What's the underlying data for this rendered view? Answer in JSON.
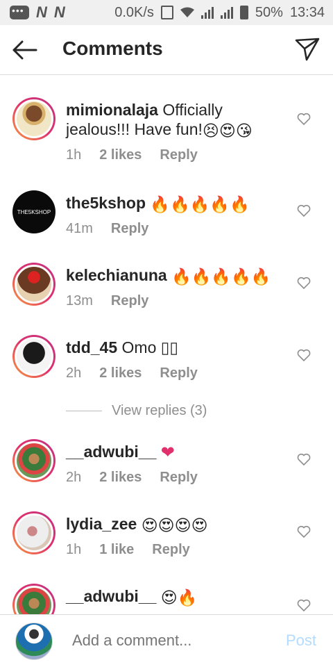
{
  "status_bar": {
    "carrier_1": "N",
    "carrier_2": "N",
    "speed": "0.0K/s",
    "battery": "50%",
    "time": "13:34"
  },
  "header": {
    "title": "Comments"
  },
  "comments": [
    {
      "username": "mimionalaja",
      "text": "Officially jealous!!! Have fun!",
      "emojis": "😣😍😘",
      "time": "1h",
      "likes": "2 likes",
      "reply": "Reply"
    },
    {
      "username": "the5kshop",
      "text": "",
      "emojis": "🔥🔥🔥🔥🔥",
      "time": "41m",
      "likes": "",
      "reply": "Reply",
      "avatar_text": "THE5KSHOP"
    },
    {
      "username": "kelechianuna",
      "text": "",
      "emojis": "🔥🔥🔥🔥🔥",
      "time": "13m",
      "likes": "",
      "reply": "Reply"
    },
    {
      "username": "tdd_45",
      "text": "Omo ▯▯",
      "emojis": "",
      "time": "2h",
      "likes": "2 likes",
      "reply": "Reply"
    },
    {
      "username": "__adwubi__",
      "text": "",
      "emojis": "❤",
      "time": "2h",
      "likes": "2 likes",
      "reply": "Reply"
    },
    {
      "username": "lydia_zee",
      "text": "",
      "emojis": "😍😍😍😍",
      "time": "1h",
      "likes": "1 like",
      "reply": "Reply"
    },
    {
      "username": "__adwubi__",
      "text": "",
      "emojis": "😍🔥",
      "time": "",
      "likes": "",
      "reply": ""
    }
  ],
  "view_replies": "View replies (3)",
  "composer": {
    "placeholder": "Add a comment...",
    "post_label": "Post"
  },
  "colors": {
    "post_disabled": "#b3dbff",
    "meta_gray": "#8e8e8e",
    "heart_pink": "#e1306c"
  }
}
